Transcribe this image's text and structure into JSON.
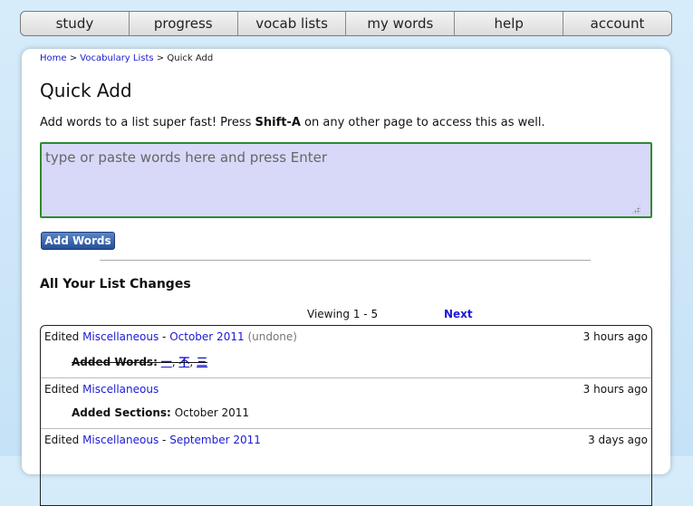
{
  "nav": {
    "items": [
      {
        "label": "study"
      },
      {
        "label": "progress"
      },
      {
        "label": "vocab lists"
      },
      {
        "label": "my words"
      },
      {
        "label": "help"
      },
      {
        "label": "account"
      }
    ]
  },
  "breadcrumb": {
    "home": "Home",
    "sep1": ">",
    "lists": "Vocabulary Lists",
    "sep2": ">",
    "current": "Quick Add"
  },
  "page": {
    "title": "Quick Add",
    "intro_pre": "Add words to a list super fast! Press ",
    "intro_key": "Shift-A",
    "intro_post": " on any other page to access this as well."
  },
  "quick_add": {
    "placeholder": "type or paste words here and press Enter",
    "value": "",
    "button_label": "Add Words"
  },
  "changes": {
    "title": "All Your List Changes",
    "viewing": "Viewing 1 - 5",
    "next": "Next",
    "rows": [
      {
        "action": "Edited",
        "list": "Miscellaneous",
        "dash": "-",
        "section": "October 2011",
        "status": "(undone)",
        "time": "3 hours ago",
        "detail_label": "Added Words:",
        "words": [
          "一",
          "不",
          "三"
        ],
        "sep": ","
      },
      {
        "action": "Edited",
        "list": "Miscellaneous",
        "time": "3 hours ago",
        "detail_label": "Added Sections:",
        "detail_value": "October 2011"
      },
      {
        "action": "Edited",
        "list": "Miscellaneous",
        "dash": "-",
        "section": "September 2011",
        "time": "3 days ago"
      }
    ]
  },
  "colors": {
    "background": "#cce4f7",
    "link": "#1a1ad6",
    "input_bg": "#d8d8f8",
    "input_border": "#2e8b2e",
    "button": "#2f5ca8"
  }
}
